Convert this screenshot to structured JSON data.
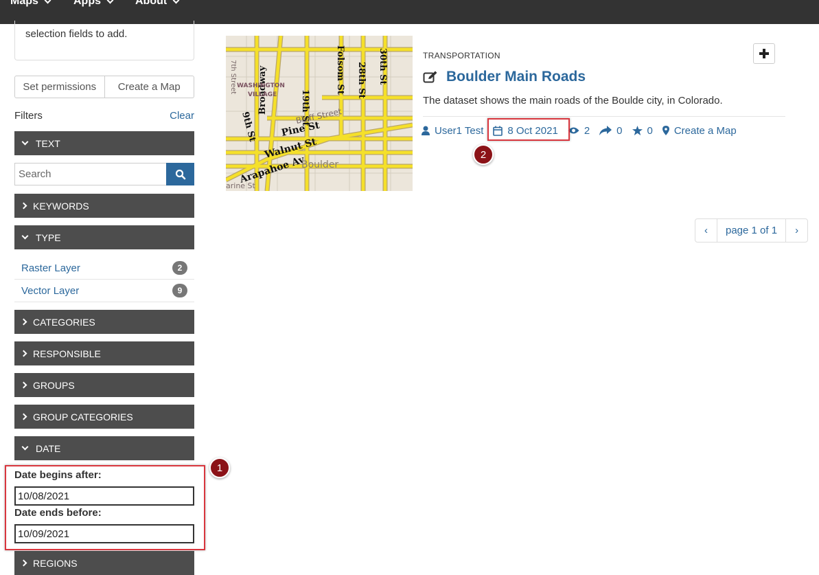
{
  "navbar": {
    "items": [
      "Maps",
      "Apps",
      "About"
    ]
  },
  "sidebar": {
    "hint_text": "selection fields to add.",
    "buttons": {
      "permissions": "Set permissions",
      "create_map": "Create a Map"
    },
    "filters_title": "Filters",
    "clear_label": "Clear",
    "search_placeholder": "Search",
    "facets": {
      "text": "TEXT",
      "keywords": "KEYWORDS",
      "type": "TYPE",
      "categories": "CATEGORIES",
      "responsible": "RESPONSIBLE",
      "groups": "GROUPS",
      "group_categories": "GROUP CATEGORIES",
      "date": "DATE",
      "regions": "REGIONS"
    },
    "types": [
      {
        "label": "Raster Layer",
        "count": "2"
      },
      {
        "label": "Vector Layer",
        "count": "9"
      }
    ],
    "date": {
      "begins_label": "Date begins after:",
      "begins_value": "10/08/2021",
      "ends_label": "Date ends before:",
      "ends_value": "10/09/2021"
    }
  },
  "result": {
    "category": "TRANSPORTATION",
    "title": "Boulder Main Roads",
    "description": "The dataset shows the main roads of the Boulde city, in Colorado.",
    "owner": "User1 Test",
    "date": "8 Oct 2021",
    "views": "2",
    "shares": "0",
    "favorites": "0",
    "create_map": "Create a Map",
    "map_labels": {
      "s7th": "7th Street",
      "broadway": "Broadway",
      "washington": "WASHINGTON",
      "village": "VILLAGE",
      "s19th": "19th St",
      "folsom": "Folsom St",
      "s28th": "28th St",
      "s30th": "30th St",
      "bluff": "Bluff Street",
      "s9th": "9th St",
      "pine": "Pine St",
      "walnut": "Walnut St",
      "arapahoe": "Arapahoe Av",
      "boulder": "Boulder",
      "marine": "arine St"
    }
  },
  "pagination": {
    "prev": "‹",
    "page": "page 1 of 1",
    "next": "›"
  },
  "annotations": {
    "marker1": "1",
    "marker2": "2"
  },
  "colors": {
    "accent": "#2c689c",
    "facet_bg": "#4d4d4d",
    "highlight": "#d9363e",
    "marker": "#8b1217"
  }
}
